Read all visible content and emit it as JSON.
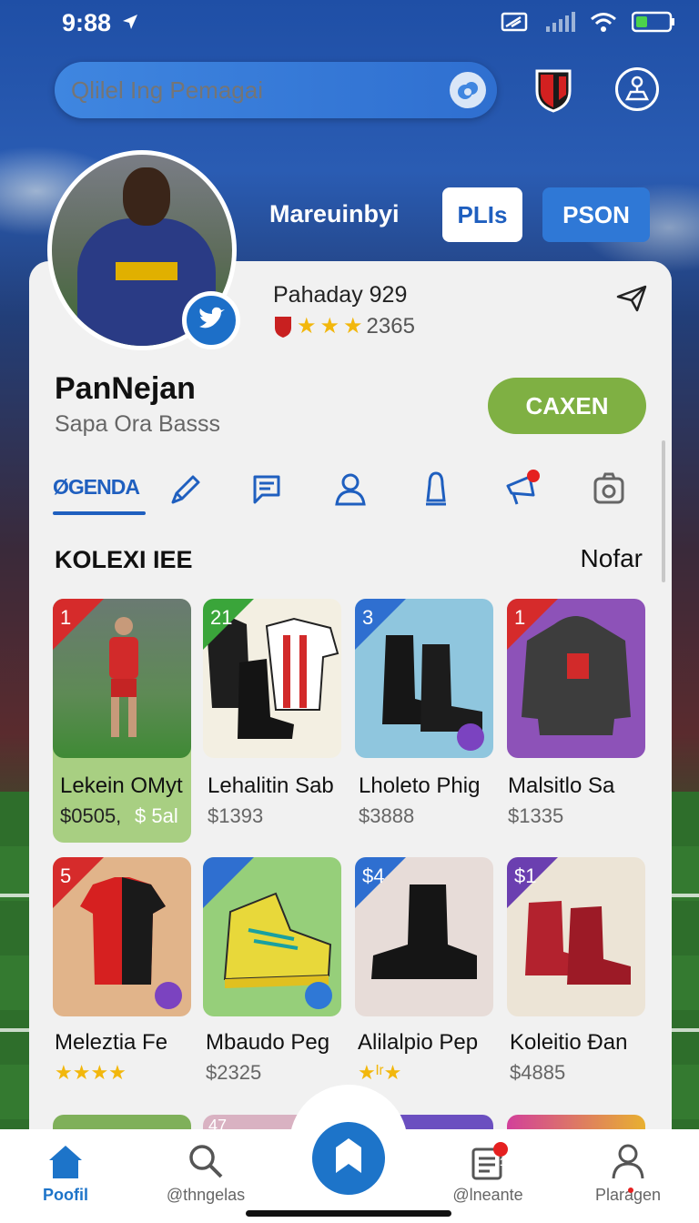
{
  "status": {
    "time": "9:88"
  },
  "search": {
    "placeholder": "Qlilel Ing Pemagai"
  },
  "profile": {
    "handle": "Mareuinbyi",
    "buttons": {
      "plis": "PLIs",
      "pson": "PSON"
    },
    "info_title": "Pahaday 929",
    "rating_value": "2365",
    "name": "PanNejan",
    "subtitle": "Sapa Ora Basss",
    "action_label": "CAXEN"
  },
  "tabs": {
    "first_label": "GENDA",
    "prefix": "Ø"
  },
  "section": {
    "title": "KOLEXI IEE",
    "more": "Nofar"
  },
  "products": [
    {
      "badge": "1",
      "name": "Lekein OMyt",
      "price": "$0505,",
      "price2": "$ 5al",
      "accent": "#d62b2b"
    },
    {
      "badge": "21",
      "name": "Lehalitin Sab",
      "price": "$1393",
      "accent": "#3aa53a"
    },
    {
      "badge": "3",
      "name": "Lholeto Phig",
      "price": "$3888",
      "accent": "#2f6fd0"
    },
    {
      "badge": "1",
      "name": "Malsitlo Sa",
      "price": "$1335",
      "accent": "#d62b2b"
    },
    {
      "badge": "5",
      "name": "Meleztia Fe",
      "price": "★★★★",
      "accent": "#d62b2b"
    },
    {
      "badge": "",
      "name": "Mbaudo Peg",
      "price": "$2325",
      "accent": "#2f6fd0"
    },
    {
      "badge": "$4",
      "name": "Alilalpio Pep",
      "price": "★ᴵʳ★",
      "accent": "#2f6fd0"
    },
    {
      "badge": "$1",
      "name": "Koleitio Ðan",
      "price": "$4885",
      "accent": "#6b3fb0"
    }
  ],
  "peek_badges": [
    "",
    "47",
    "",
    ""
  ],
  "nav": {
    "home": "Poofil",
    "search": "@thngelas",
    "news": "@lneante",
    "profile": "Plaragen",
    "news_badge": "1"
  },
  "colors": {
    "primary": "#1f5fbf",
    "accent_green": "#7fb043",
    "star": "#f2b70c",
    "card": "#f1f1f1"
  }
}
